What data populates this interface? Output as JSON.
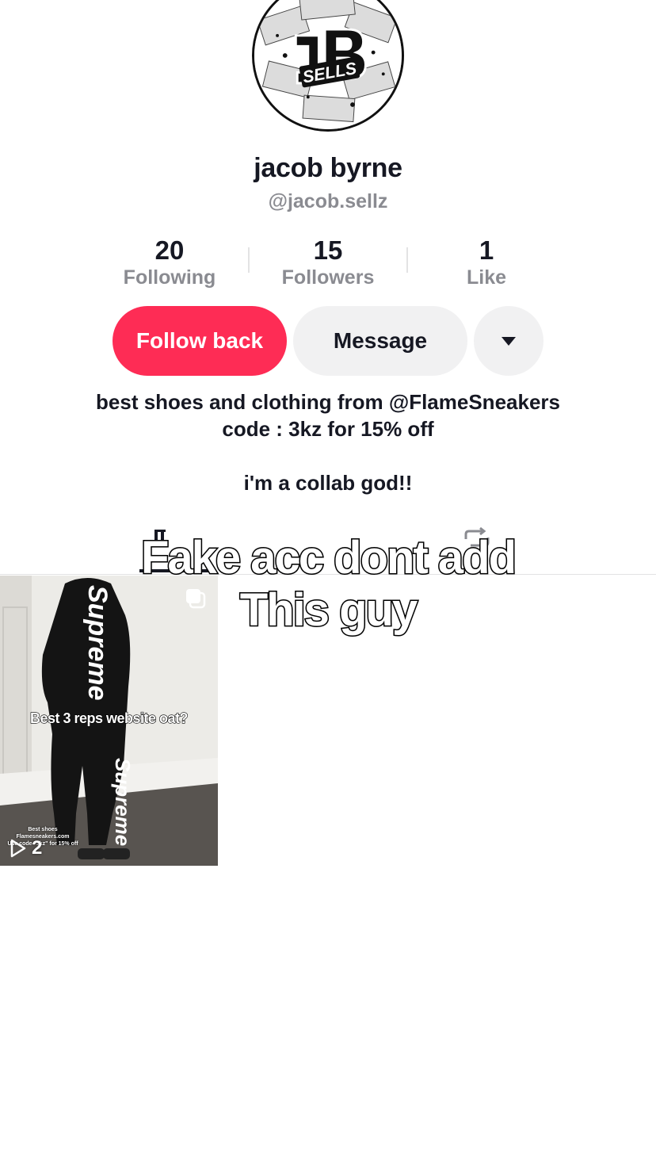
{
  "profile": {
    "avatar_logo_text": "JB SELLS",
    "name": "jacob byrne",
    "handle": "@jacob.sellz"
  },
  "stats": [
    {
      "value": "20",
      "label": "Following"
    },
    {
      "value": "15",
      "label": "Followers"
    },
    {
      "value": "1",
      "label": "Like"
    }
  ],
  "actions": {
    "follow_back": "Follow back",
    "message": "Message",
    "more_icon": "caret-down-icon"
  },
  "bio": {
    "line1_prefix": "best shoes and clothing from ",
    "line1_mention": "@FlameSneakers",
    "line2": "code : 3kz for 15% off",
    "line3": "i'm a collab god!!"
  },
  "tabs": {
    "icons": [
      "grid-icon",
      "repost-icon"
    ]
  },
  "overlay_text": {
    "line1": "Fake acc dont add",
    "line2": "This guy"
  },
  "videos": [
    {
      "caption": "Best 3 reps website oat?",
      "small_text_1": "Best shoes",
      "small_text_2": "Flamesneakers.com",
      "small_text_3": "Use code \"3kz\" for 15% off",
      "views": "2",
      "hoodie_text": "Supreme"
    }
  ],
  "colors": {
    "follow_button": "#fe2c55",
    "secondary_button": "#f1f1f2",
    "muted_text": "#8a8b91",
    "primary_text": "#161823"
  }
}
